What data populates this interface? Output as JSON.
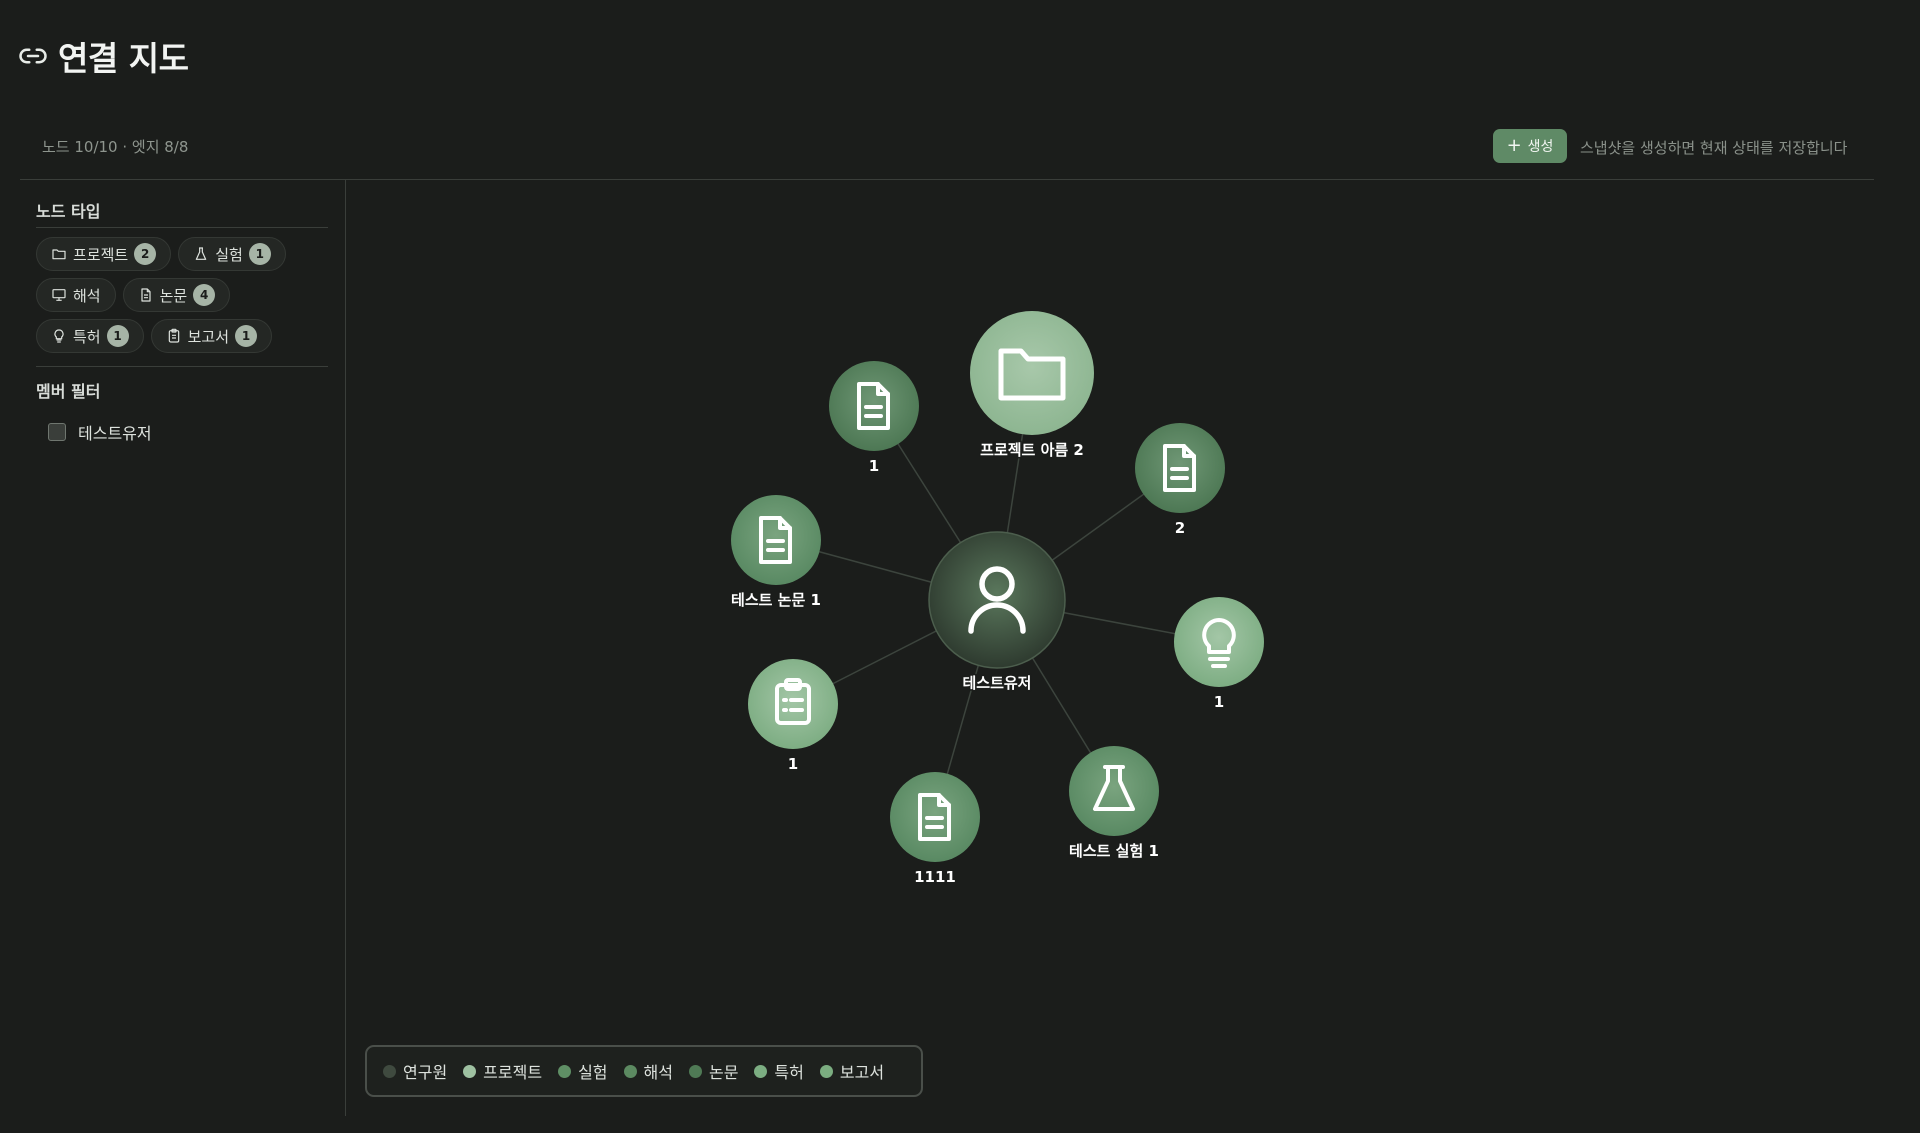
{
  "header": {
    "title": "연결 지도",
    "icon": "link-icon"
  },
  "stats": {
    "text": "노드 10/10 · 엣지 8/8"
  },
  "snapshot": {
    "create_label": "생성",
    "hint": "스냅샷을 생성하면 현재 상태를 저장합니다"
  },
  "sidebar": {
    "node_types_title": "노드 타입",
    "node_types": [
      {
        "label": "프로젝트",
        "count": "2",
        "icon": "folder-icon"
      },
      {
        "label": "실험",
        "count": "1",
        "icon": "flask-icon"
      },
      {
        "label": "해석",
        "icon": "monitor-icon"
      },
      {
        "label": "논문",
        "count": "4",
        "icon": "document-icon"
      },
      {
        "label": "특허",
        "count": "1",
        "icon": "lightbulb-icon"
      },
      {
        "label": "보고서",
        "count": "1",
        "icon": "clipboard-icon"
      }
    ],
    "member_filter_title": "멤버 필터",
    "members": [
      {
        "label": "테스트유저",
        "checked": false
      }
    ]
  },
  "graph": {
    "center": {
      "label": "테스트유저",
      "icon": "user-icon",
      "color": "#435c45"
    },
    "nodes": [
      {
        "label": "프로젝트 아름 2",
        "icon": "folder-icon",
        "color": "#94ba97"
      },
      {
        "label": "1",
        "icon": "document-icon",
        "color": "#4e7c55"
      },
      {
        "label": "2",
        "icon": "document-icon",
        "color": "#4e7c55"
      },
      {
        "label": "테스트 논문 1",
        "icon": "document-icon",
        "color": "#4e7c55"
      },
      {
        "label": "1",
        "icon": "lightbulb-icon",
        "color": "#7fae84"
      },
      {
        "label": "1",
        "icon": "clipboard-icon",
        "color": "#7fae84"
      },
      {
        "label": "1111",
        "icon": "document-icon",
        "color": "#4e7c55"
      },
      {
        "label": "테스트 실험 1",
        "icon": "flask-icon",
        "color": "#5a8a60"
      }
    ]
  },
  "legend": [
    {
      "label": "연구원",
      "color": "#3f4a3f"
    },
    {
      "label": "프로젝트",
      "color": "#9ec1a1"
    },
    {
      "label": "실험",
      "color": "#5f8f65"
    },
    {
      "label": "해석",
      "color": "#5c8a61"
    },
    {
      "label": "논문",
      "color": "#4f7a55"
    },
    {
      "label": "특허",
      "color": "#7cae82"
    },
    {
      "label": "보고서",
      "color": "#7bad80"
    }
  ]
}
